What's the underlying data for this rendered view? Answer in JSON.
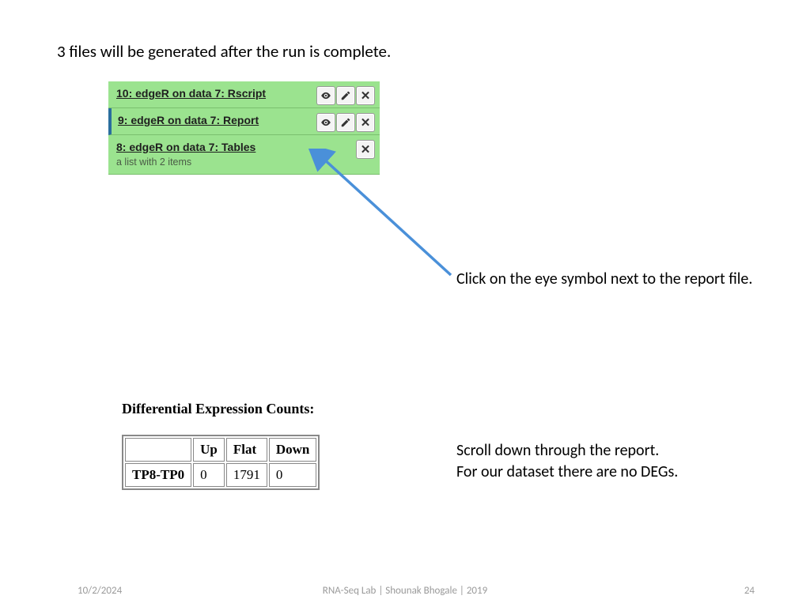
{
  "heading": "3 files will be generated after the run is complete.",
  "history": [
    {
      "title": "10: edgeR on data 7: Rscript",
      "sub": "",
      "actions": [
        "eye",
        "edit",
        "close"
      ],
      "selected": false
    },
    {
      "title": "9: edgeR on data 7: Report",
      "sub": "",
      "actions": [
        "eye",
        "edit",
        "close"
      ],
      "selected": true
    },
    {
      "title": "8: edgeR on data 7: Tables",
      "sub": "a list with 2 items",
      "actions": [
        "close"
      ],
      "selected": false
    }
  ],
  "callout1": "Click on the eye symbol next to the report file.",
  "callout2_line1": "Scroll down through the report.",
  "callout2_line2": "For our dataset there are no DEGs.",
  "diff": {
    "title": "Differential Expression Counts:",
    "cols": [
      "Up",
      "Flat",
      "Down"
    ],
    "row_label": "TP8-TP0",
    "row_vals": [
      "0",
      "1791",
      "0"
    ]
  },
  "footer": {
    "date": "10/2/2024",
    "center": "RNA-Seq Lab  | Shounak Bhogale | 2019",
    "page": "24"
  }
}
